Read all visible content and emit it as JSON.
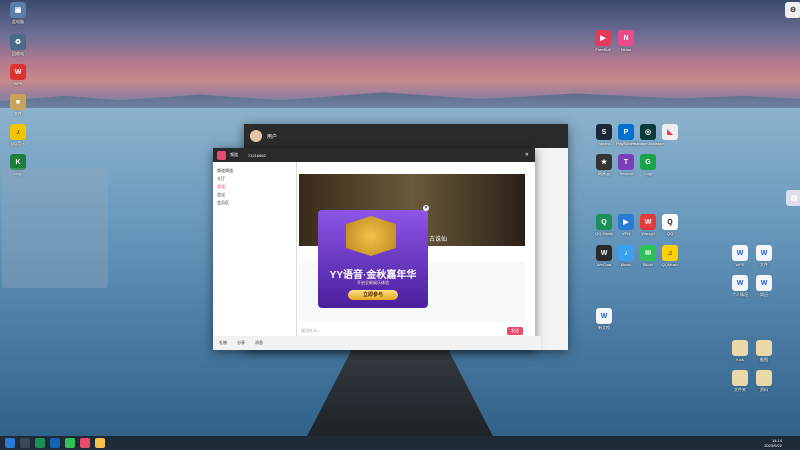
{
  "desktop_left": [
    {
      "label": "此电脑"
    },
    {
      "label": "回收站"
    },
    {
      "label": "WPS"
    },
    {
      "label": "文件"
    },
    {
      "label": "QQ音乐"
    },
    {
      "label": "Krisp"
    }
  ],
  "desktop_right_top": [
    {
      "label": "FreeBuff"
    },
    {
      "label": "Nidaa"
    }
  ],
  "desktop_right_grid": [
    {
      "label": "Steam"
    },
    {
      "label": "PlayStation"
    },
    {
      "label": "Phantom Assistant"
    },
    {
      "label": "网易云"
    },
    {
      "label": "Tencent"
    },
    {
      "label": "Logi"
    },
    {
      "label": "QQ Music"
    },
    {
      "label": "VPN"
    },
    {
      "label": "Wangyi"
    },
    {
      "label": "QQ"
    },
    {
      "label": "WeChat"
    },
    {
      "label": "Music"
    },
    {
      "label": "Bilibili"
    },
    {
      "label": "QQMusic"
    }
  ],
  "desktop_right_files": [
    {
      "label": "WPS"
    },
    {
      "label": "文件"
    },
    {
      "label": "个人情况"
    },
    {
      "label": "简历"
    },
    {
      "label": "新文档"
    }
  ],
  "desktop_right_folders": [
    {
      "label": "Kick"
    },
    {
      "label": "截图"
    },
    {
      "label": "文件夹"
    },
    {
      "label": "资料"
    }
  ],
  "chat_window": {
    "title": "用户",
    "room_id": "71216662",
    "channel": "频道",
    "tabs": [
      "聊天",
      "公告"
    ],
    "notice": "点击聊天",
    "input_placeholder": "说点什么...",
    "send_label": "发送",
    "tree": [
      "频道频道",
      "大厅",
      "频道",
      "会议",
      "会员区"
    ],
    "bottom_items": [
      "礼物",
      "分享",
      "消息"
    ]
  },
  "ad": {
    "title": "YY语音·金秋嘉年华",
    "subtitle": "开启全新娱乐体验",
    "button": "立即参与",
    "game_label": "古诛仙"
  },
  "taskbar": {
    "time": "14:14",
    "date": "2023/9/22"
  },
  "colors": {
    "accent": "#e94b6c",
    "ad_gold": "#f2c24a",
    "ad_purple": "#6b3fb8"
  }
}
